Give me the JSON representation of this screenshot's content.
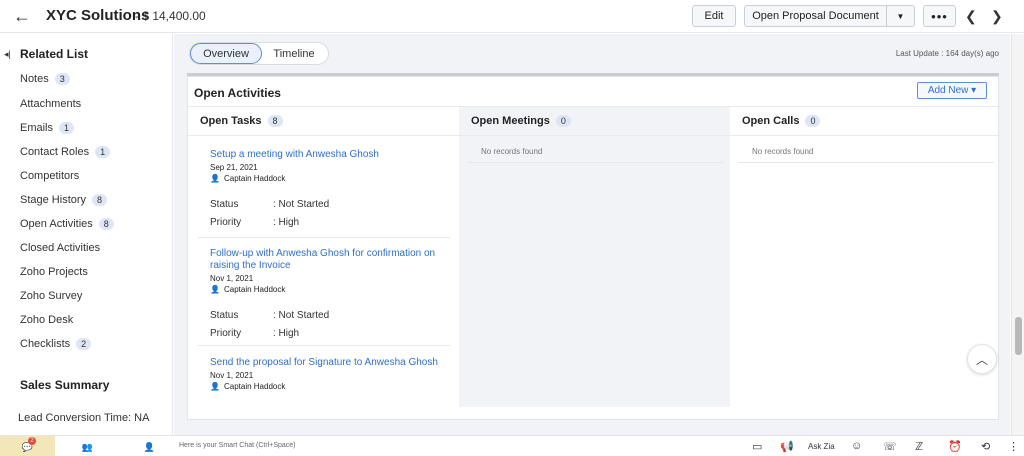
{
  "header": {
    "title": "XYC Solutions",
    "amount": "- $ 14,400.00",
    "edit_label": "Edit",
    "open_proposal_label": "Open Proposal Document",
    "more_label": "•••"
  },
  "sidebar": {
    "heading": "Related List",
    "items": [
      {
        "label": "Notes",
        "badge": "3"
      },
      {
        "label": "Attachments",
        "badge": ""
      },
      {
        "label": "Emails",
        "badge": "1"
      },
      {
        "label": "Contact Roles",
        "badge": "1"
      },
      {
        "label": "Competitors",
        "badge": ""
      },
      {
        "label": "Stage History",
        "badge": "8"
      },
      {
        "label": "Open Activities",
        "badge": "8"
      },
      {
        "label": "Closed Activities",
        "badge": ""
      },
      {
        "label": "Zoho Projects",
        "badge": ""
      },
      {
        "label": "Zoho Survey",
        "badge": ""
      },
      {
        "label": "Zoho Desk",
        "badge": ""
      },
      {
        "label": "Checklists",
        "badge": "2"
      }
    ],
    "sales_summary": "Sales Summary",
    "lead_conversion": "Lead Conversion Time: NA"
  },
  "main": {
    "tabs": [
      {
        "label": "Overview"
      },
      {
        "label": "Timeline"
      }
    ],
    "last_update": "Last Update : 164 day(s) ago",
    "card_title": "Open Activities",
    "add_new_label": "Add New ▾",
    "columns": {
      "tasks": {
        "label": "Open Tasks",
        "count": "8"
      },
      "meetings": {
        "label": "Open Meetings",
        "count": "0",
        "empty": "No records found"
      },
      "calls": {
        "label": "Open Calls",
        "count": "0",
        "empty": "No records found"
      }
    },
    "tasks": [
      {
        "title": "Setup a meeting with Anwesha Ghosh",
        "date": "Sep 21, 2021",
        "owner": "Captain Haddock",
        "status_label": "Status",
        "status": ": Not Started",
        "priority_label": "Priority",
        "priority": ": High"
      },
      {
        "title": "Follow-up with Anwesha Ghosh for confirmation on raising the Invoice",
        "date": "Nov 1, 2021",
        "owner": "Captain Haddock",
        "status_label": "Status",
        "status": ": Not Started",
        "priority_label": "Priority",
        "priority": ": High"
      },
      {
        "title": "Send the proposal for Signature to Anwesha Ghosh",
        "date": "Nov 1, 2021",
        "owner": "Captain Haddock"
      }
    ]
  },
  "bottom_bar": {
    "notification_count": "2",
    "smart_chat_placeholder": "Here is your Smart Chat (Ctrl+Space)",
    "ask_zia": "Ask Zia"
  }
}
